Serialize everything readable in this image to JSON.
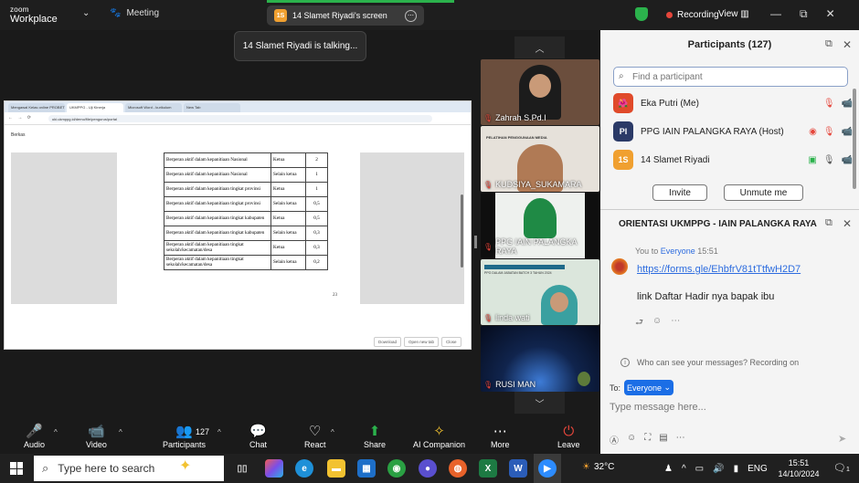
{
  "topbar": {
    "logo_top": "zoom",
    "logo_bottom": "Workplace",
    "meeting_label": "Meeting",
    "screen_avatar": "1S",
    "screen_label": "14 Slamet Riyadi's screen",
    "talking": "14 Slamet Riyadi is talking..."
  },
  "share": {
    "tabs": [
      "Mengawal Kelas online PROBET",
      "UKMPPG - Uji Kinerja",
      "Microsoft Word - kurikulum",
      "New Tab"
    ],
    "url": "uki.ukmppg.id/demo/file/pengurus/portal",
    "doc_header": "Berkas",
    "table": [
      [
        "Berperan aktif dalam kepanitiaan Nasional",
        "Ketua",
        "2"
      ],
      [
        "Berperan aktif dalam kepanitiaan Nasional",
        "Selain ketua",
        "1"
      ],
      [
        "Berperan aktif dalam kepanitiaan tingkat provinsi",
        "Ketua",
        "1"
      ],
      [
        "Berperan aktif dalam kepanitiaan tingkat provinsi",
        "Selain ketua",
        "0,5"
      ],
      [
        "Berperan aktif dalam kepanitiaan tingkat kabupaten",
        "Ketua",
        "0,5"
      ],
      [
        "Berperan aktif dalam kepanitiaan tingkat kabupaten",
        "Selain ketua",
        "0,3"
      ],
      [
        "Berperan aktif dalam kepanitiaan tingkat sekolah/kecamatan/desa",
        "Ketua",
        "0,3"
      ],
      [
        "Berperan aktif dalam kepanitiaan tingkat sekolah/kecamatan/desa",
        "Selain ketua",
        "0,2"
      ]
    ],
    "page_number": "23",
    "buttons": [
      "Download",
      "Open new tab",
      "Close"
    ]
  },
  "videos": [
    {
      "name": "Zahrah S.Pd.I",
      "bg": "#7a5a4a"
    },
    {
      "name": "KUDSIYA_SUKAMARA",
      "bg": "#cfc9c2"
    },
    {
      "name": "PPG IAIN PALANGKA RAYA",
      "bg": "#e9ece9"
    },
    {
      "name": "linda wati",
      "bg": "#d6e4d8"
    },
    {
      "name": "RUSI MAN",
      "bg": "#0c1d3d"
    }
  ],
  "tile2_caption": "PELATIHAN PENGGUNAAN MEDIA",
  "tile4_caption": "PPG DALAM JABATAN BATCH 3 TAHUN 2024",
  "controls": [
    {
      "label": "Audio",
      "icon": "🎤"
    },
    {
      "label": "Video",
      "icon": "📹"
    },
    {
      "label": "Participants",
      "icon": "👥"
    },
    {
      "label": "Chat",
      "icon": "💬"
    },
    {
      "label": "React",
      "icon": "♡"
    },
    {
      "label": "Share",
      "icon": "⬆"
    },
    {
      "label": "AI Companion",
      "icon": "✧"
    },
    {
      "label": "More",
      "icon": "⋯"
    },
    {
      "label": "Leave",
      "icon": "⏻"
    }
  ],
  "participants_count_badge": "127",
  "panel": {
    "recording": "Recording",
    "view": "View",
    "title": "Participants (127)",
    "find_placeholder": "Find a participant",
    "participants": [
      {
        "name": "Eka Putri (Me)",
        "avatar": "",
        "color": "#e04a2a"
      },
      {
        "name": "PPG IAIN PALANGKA RAYA (Host)",
        "avatar": "PI",
        "color": "#2b3a67"
      },
      {
        "name": "14 Slamet Riyadi",
        "avatar": "1S",
        "color": "#f0a030"
      }
    ],
    "invite": "Invite",
    "unmute_me": "Unmute me",
    "chat_title": "ORIENTASI UKMPPG - IAIN PALANGKA RAYA",
    "msg_from": "You to",
    "msg_to": "Everyone",
    "msg_time": "15:51",
    "msg_link": "https://forms.gle/EhbfrV81tTtfwH2D7",
    "msg_text": "link Daftar Hadir nya bapak ibu",
    "who_can_see": "Who can see your messages? Recording on",
    "to_label": "To:",
    "to_value": "Everyone",
    "input_placeholder": "Type message here..."
  },
  "taskbar": {
    "search": "Type here to search",
    "temperature": "32°C",
    "lang": "ENG",
    "time": "15:51",
    "date": "14/10/2024",
    "notifications": "1"
  }
}
